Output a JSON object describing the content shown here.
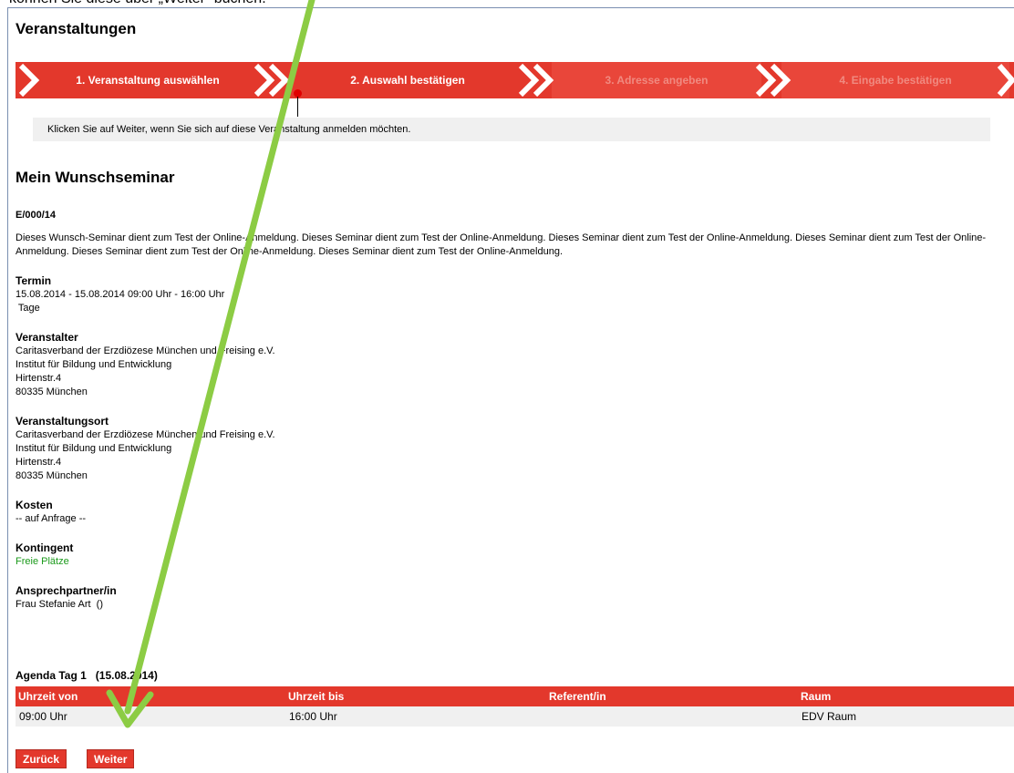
{
  "caption": "können Sie diese über „Weiter“ buchen.",
  "page_title": "Veranstaltungen",
  "steps": [
    {
      "label": "1. Veranstaltung auswählen",
      "active": true
    },
    {
      "label": "2. Auswahl bestätigen",
      "active": true
    },
    {
      "label": "3. Adresse angeben",
      "active": false
    },
    {
      "label": "4. Eingabe bestätigen",
      "active": false
    }
  ],
  "info_text": "Klicken Sie auf Weiter, wenn Sie sich auf diese Veranstaltung anmelden möchten.",
  "seminar": {
    "title": "Mein Wunschseminar",
    "code": "E/000/14",
    "description": "Dieses Wunsch-Seminar dient zum Test der Online-Anmeldung. Dieses Seminar dient zum Test der Online-Anmeldung. Dieses Seminar dient zum Test der Online-Anmeldung. Dieses Seminar dient zum Test der Online-Anmeldung. Dieses Seminar dient zum Test der Online-Anmeldung. Dieses Seminar dient zum Test der Online-Anmeldung."
  },
  "termin": {
    "heading": "Termin",
    "line1": "15.08.2014 - 15.08.2014  09:00 Uhr - 16:00 Uhr",
    "line2": " Tage"
  },
  "veranstalter": {
    "heading": "Veranstalter",
    "lines": [
      "Caritasverband der Erzdiözese München und Freising e.V.",
      "Institut für Bildung und Entwicklung",
      "Hirtenstr.4",
      "80335 München"
    ]
  },
  "veranstaltungsort": {
    "heading": "Veranstaltungsort",
    "lines": [
      "Caritasverband der Erzdiözese München und Freising e.V.",
      "Institut für Bildung und Entwicklung",
      "Hirtenstr.4",
      "80335 München"
    ]
  },
  "kosten": {
    "heading": "Kosten",
    "value": "-- auf Anfrage --"
  },
  "kontingent": {
    "heading": "Kontingent",
    "value": "Freie Plätze",
    "value_color": "#1a9a1a"
  },
  "ansprechpartner": {
    "heading": "Ansprechpartner/in",
    "value": "Frau Stefanie Art  ()"
  },
  "agenda": {
    "title": "Agenda Tag 1   (15.08.2014)",
    "columns": [
      "Uhrzeit von",
      "Uhrzeit bis",
      "Referent/in",
      "Raum"
    ],
    "rows": [
      [
        "09:00 Uhr",
        "16:00 Uhr",
        "",
        "EDV Raum"
      ]
    ]
  },
  "buttons": {
    "back": "Zurück",
    "next": "Weiter"
  },
  "colors": {
    "accent": "#e3382c",
    "arrow": "#8ccc44"
  }
}
